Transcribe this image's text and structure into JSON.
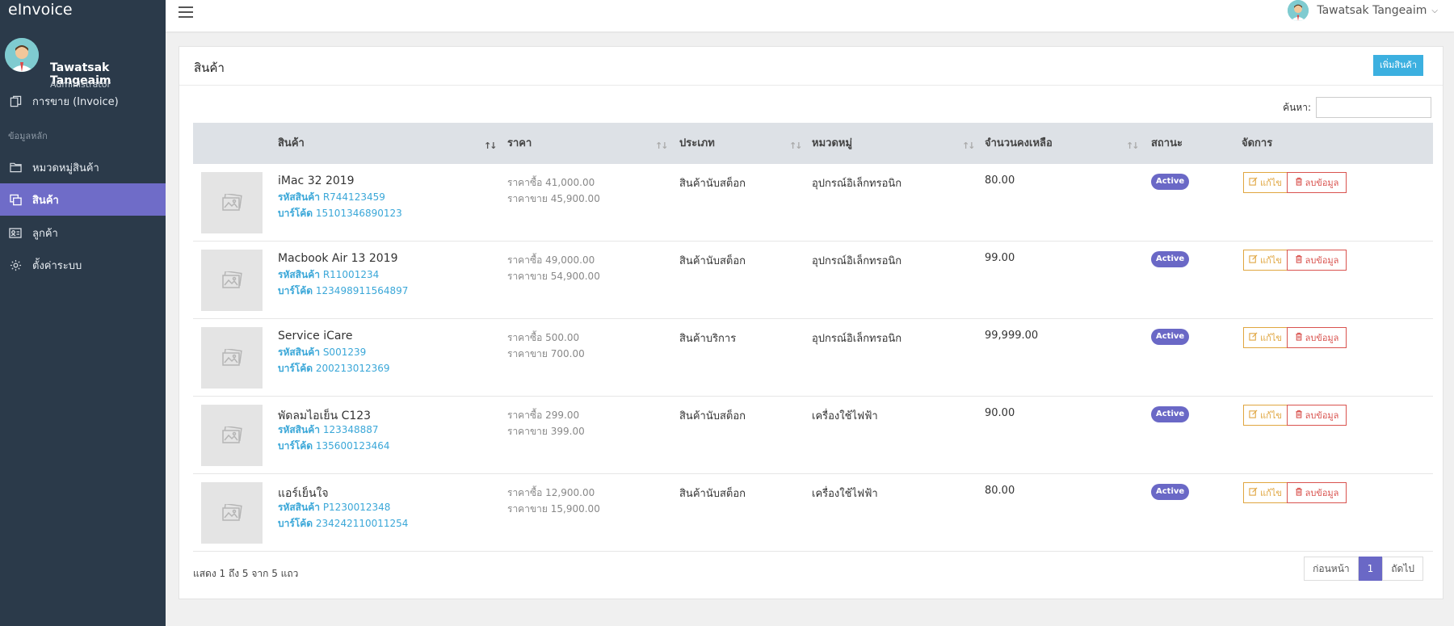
{
  "app": {
    "brand": "eInvoice"
  },
  "user": {
    "name": "Tawatsak Tangeaim",
    "role": "Administrator"
  },
  "sidebar": {
    "items": [
      {
        "label": "การขาย (Invoice)",
        "icon": "copy-icon"
      },
      {
        "label": "ข้อมูลหลัก",
        "icon": ""
      },
      {
        "label": "หมวดหมู่สินค้า",
        "icon": "folder-icon"
      },
      {
        "label": "สินค้า",
        "icon": "product-icon"
      },
      {
        "label": "ลูกค้า",
        "icon": "id-card-icon"
      },
      {
        "label": "ตั้งค่าระบบ",
        "icon": "gear-icon"
      }
    ]
  },
  "page": {
    "title": "สินค้า",
    "add_button": "เพิ่มสินค้า",
    "search_label": "ค้นหา:",
    "search_value": ""
  },
  "table": {
    "headers": [
      "สินค้า",
      "ราคา",
      "ประเภท",
      "หมวดหมู่",
      "จำนวนคงเหลือ",
      "สถานะ",
      "จัดการ"
    ],
    "code_label": "รหัสสินค้า",
    "barcode_label": "บาร์โค้ด",
    "buy_label": "ราคาซื้อ",
    "sell_label": "ราคาขาย",
    "edit_label": "แก้ไข",
    "delete_label": "ลบข้อมูล",
    "rows": [
      {
        "name": "iMac 32 2019",
        "code": "R744123459",
        "barcode": "15101346890123",
        "buy": "41,000.00",
        "sell": "45,900.00",
        "type": "สินค้านับสต็อก",
        "category": "อุปกรณ์อิเล็กทรอนิก",
        "stock": "80.00",
        "status": "Active"
      },
      {
        "name": "Macbook Air 13 2019",
        "code": "R11001234",
        "barcode": "123498911564897",
        "buy": "49,000.00",
        "sell": "54,900.00",
        "type": "สินค้านับสต็อก",
        "category": "อุปกรณ์อิเล็กทรอนิก",
        "stock": "99.00",
        "status": "Active"
      },
      {
        "name": "Service iCare",
        "code": "S001239",
        "barcode": "200213012369",
        "buy": "500.00",
        "sell": "700.00",
        "type": "สินค้าบริการ",
        "category": "อุปกรณ์อิเล็กทรอนิก",
        "stock": "99,999.00",
        "status": "Active"
      },
      {
        "name": "พัดลมไอเย็น C123",
        "code": "123348887",
        "barcode": "135600123464",
        "buy": "299.00",
        "sell": "399.00",
        "type": "สินค้านับสต็อก",
        "category": "เครื่องใช้ไฟฟ้า",
        "stock": "90.00",
        "status": "Active"
      },
      {
        "name": "แอร์เย็นใจ",
        "code": "P1230012348",
        "barcode": "234242110011254",
        "buy": "12,900.00",
        "sell": "15,900.00",
        "type": "สินค้านับสต็อก",
        "category": "เครื่องใช้ไฟฟ้า",
        "stock": "80.00",
        "status": "Active"
      }
    ]
  },
  "footer": {
    "info": "แสดง 1 ถึง 5 จาก 5 แถว",
    "prev": "ก่อนหน้า",
    "current_page": "1",
    "next": "ถัดไป"
  },
  "colors": {
    "sidebar": "#2b3a4a",
    "active": "#6f6cc8",
    "accent": "#3cb0e0"
  }
}
